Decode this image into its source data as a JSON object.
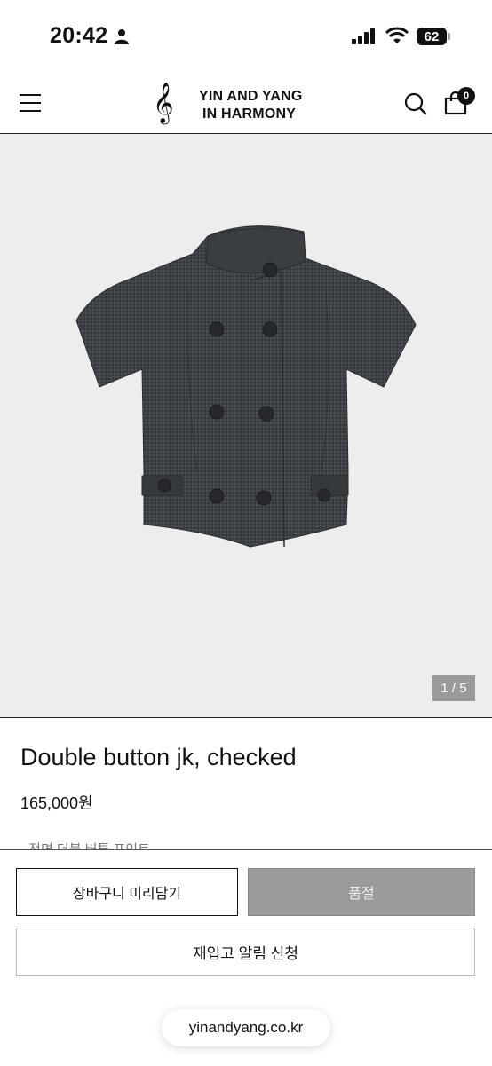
{
  "status_bar": {
    "time": "20:42",
    "battery": "62"
  },
  "header": {
    "brand_line1": "YIN AND YANG",
    "brand_line2": "IN HARMONY",
    "clef": "𝄞",
    "cart_count": "0"
  },
  "gallery": {
    "counter": "1 / 5",
    "image": "jacket-photo"
  },
  "product": {
    "title": "Double button jk, checked",
    "price": "165,000원",
    "description": "- 전면 더블 버튼 포인트"
  },
  "actions": {
    "add_to_cart": "장바구니 미리담기",
    "sold_out": "품절",
    "restock": "재입고 알림 신청"
  },
  "browser": {
    "url": "yinandyang.co.kr"
  }
}
